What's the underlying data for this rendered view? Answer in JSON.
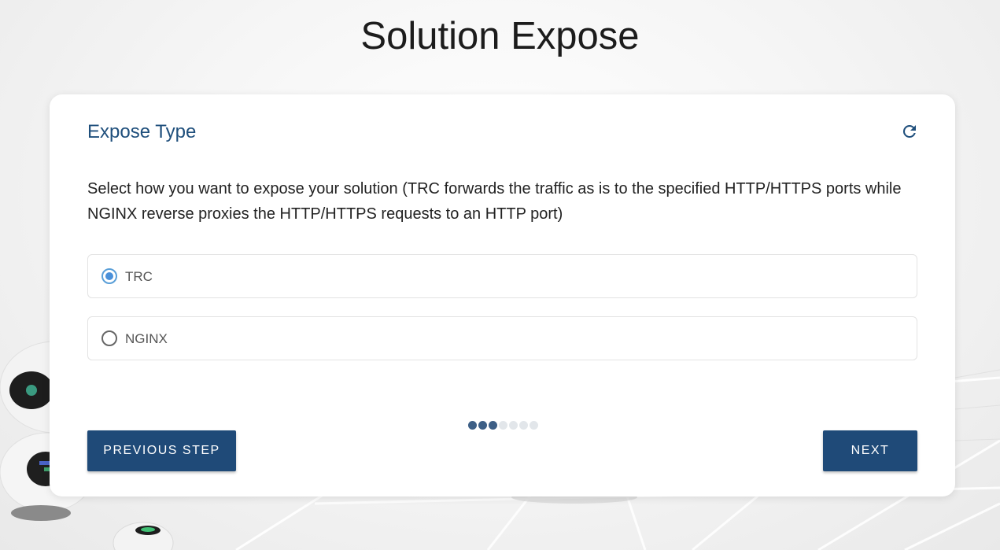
{
  "page": {
    "title": "Solution Expose"
  },
  "card": {
    "title": "Expose Type",
    "refresh_icon": "refresh-icon",
    "description": "Select how you want to expose your solution (TRC forwards the traffic as is to the specified HTTP/HTTPS ports while NGINX reverse proxies the HTTP/HTTPS requests to an HTTP port)",
    "options": [
      {
        "label": "TRC",
        "selected": true
      },
      {
        "label": "NGINX",
        "selected": false
      }
    ],
    "stepper": {
      "total_steps": 7,
      "completed_steps": 3
    },
    "buttons": {
      "previous": "PREVIOUS STEP",
      "next": "NEXT"
    }
  },
  "colors": {
    "accent": "#1f4a78",
    "title": "#1f4f7c",
    "radio_selected": "#4a90d9",
    "step_done": "#3d5f86",
    "step_pending": "#e2e6ea"
  }
}
